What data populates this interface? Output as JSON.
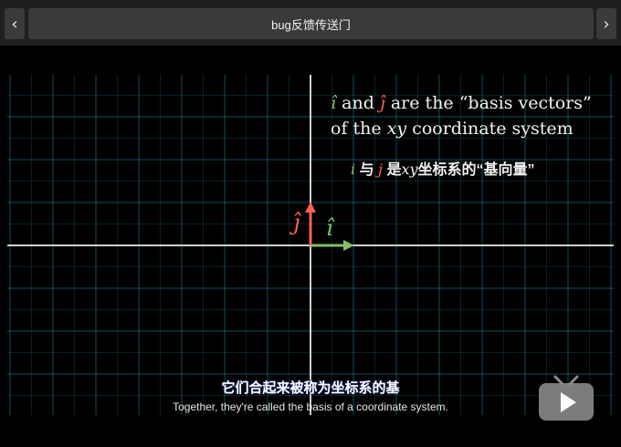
{
  "header": {
    "prev_label": "‹",
    "title": "bug反馈传送门",
    "next_label": "›"
  },
  "video": {
    "annotation_en": {
      "i_hat": "î",
      "and": "and",
      "j_hat": "ĵ",
      "line1_rest": "are the “basis vectors”",
      "of_the": "of the",
      "xy": "xy",
      "coordinate_system": "coordinate system"
    },
    "annotation_zh": {
      "i": "i",
      "yu": "与",
      "j": "j",
      "shi": "是",
      "xy": "xy",
      "rest": "坐标系的“基向量”"
    },
    "vector_labels": {
      "j_hat": "ĵ",
      "i_hat": "î"
    },
    "colors": {
      "i_vector": "#83c167",
      "j_vector": "#fc6255",
      "grid": "#29abca",
      "axes": "#cfcfcf"
    },
    "subtitles": {
      "chinese": "它们合起来被称为坐标系的基",
      "english": "Together, they're called the basis of a coordinate system."
    },
    "player_icon": "tv-play-icon"
  }
}
